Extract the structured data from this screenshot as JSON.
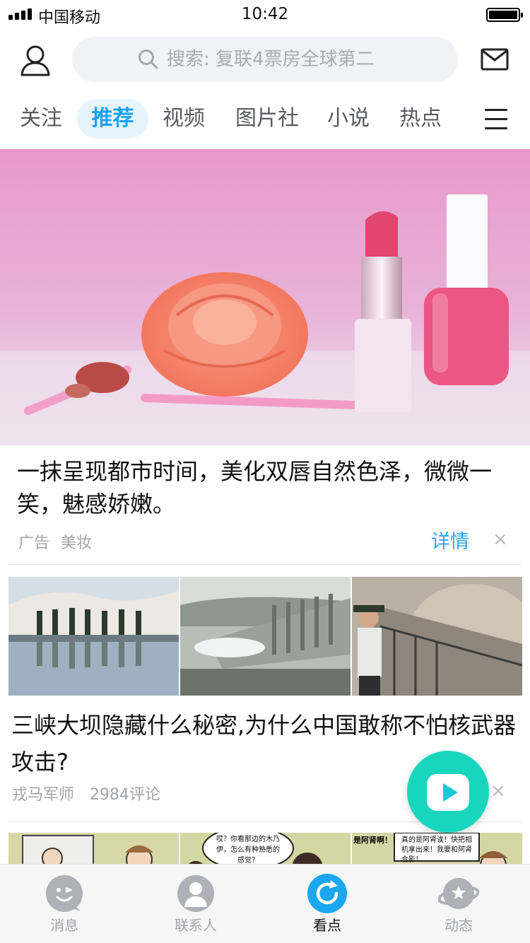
{
  "status_bar": {
    "carrier": "中国移动",
    "time": "10:42"
  },
  "header": {
    "search_placeholder": "搜索: 复联4票房全球第二"
  },
  "tabs": [
    {
      "label": "关注",
      "active": false
    },
    {
      "label": "推荐",
      "active": true
    },
    {
      "label": "视频",
      "active": false
    },
    {
      "label": "图片社",
      "active": false
    },
    {
      "label": "小说",
      "active": false
    },
    {
      "label": "热点",
      "active": false
    }
  ],
  "ad_card": {
    "title": "一抹呈现都市时间，美化双唇自然色泽，微微一笑，魅感娇嫩。",
    "tag": "广告",
    "category": "美妆",
    "detail_label": "详情",
    "close_label": "×"
  },
  "news_card": {
    "title": "三峡大坝隐藏什么秘密,为什么中国敢称不怕核武器攻击?",
    "source": "戎马军师",
    "comments": "2984评论",
    "close_label": "×"
  },
  "comic_card": {
    "bubbles": [
      "哎？你看那边的木乃伊，怎么有种熟悉的感觉？",
      "是阿肾啊！！",
      "真的是阿肾诶！快把相机拿出来！我要和阿肾合影！"
    ]
  },
  "bottom_nav": [
    {
      "label": "消息",
      "icon": "chat-bubble-icon",
      "active": false
    },
    {
      "label": "联系人",
      "icon": "contact-person-icon",
      "active": false
    },
    {
      "label": "看点",
      "icon": "refresh-icon",
      "active": true
    },
    {
      "label": "动态",
      "icon": "planet-star-icon",
      "active": false
    }
  ],
  "colors": {
    "accent": "#1aa2ef",
    "fab": "#17d6bd",
    "hero_bg": "#e9a5cf"
  }
}
